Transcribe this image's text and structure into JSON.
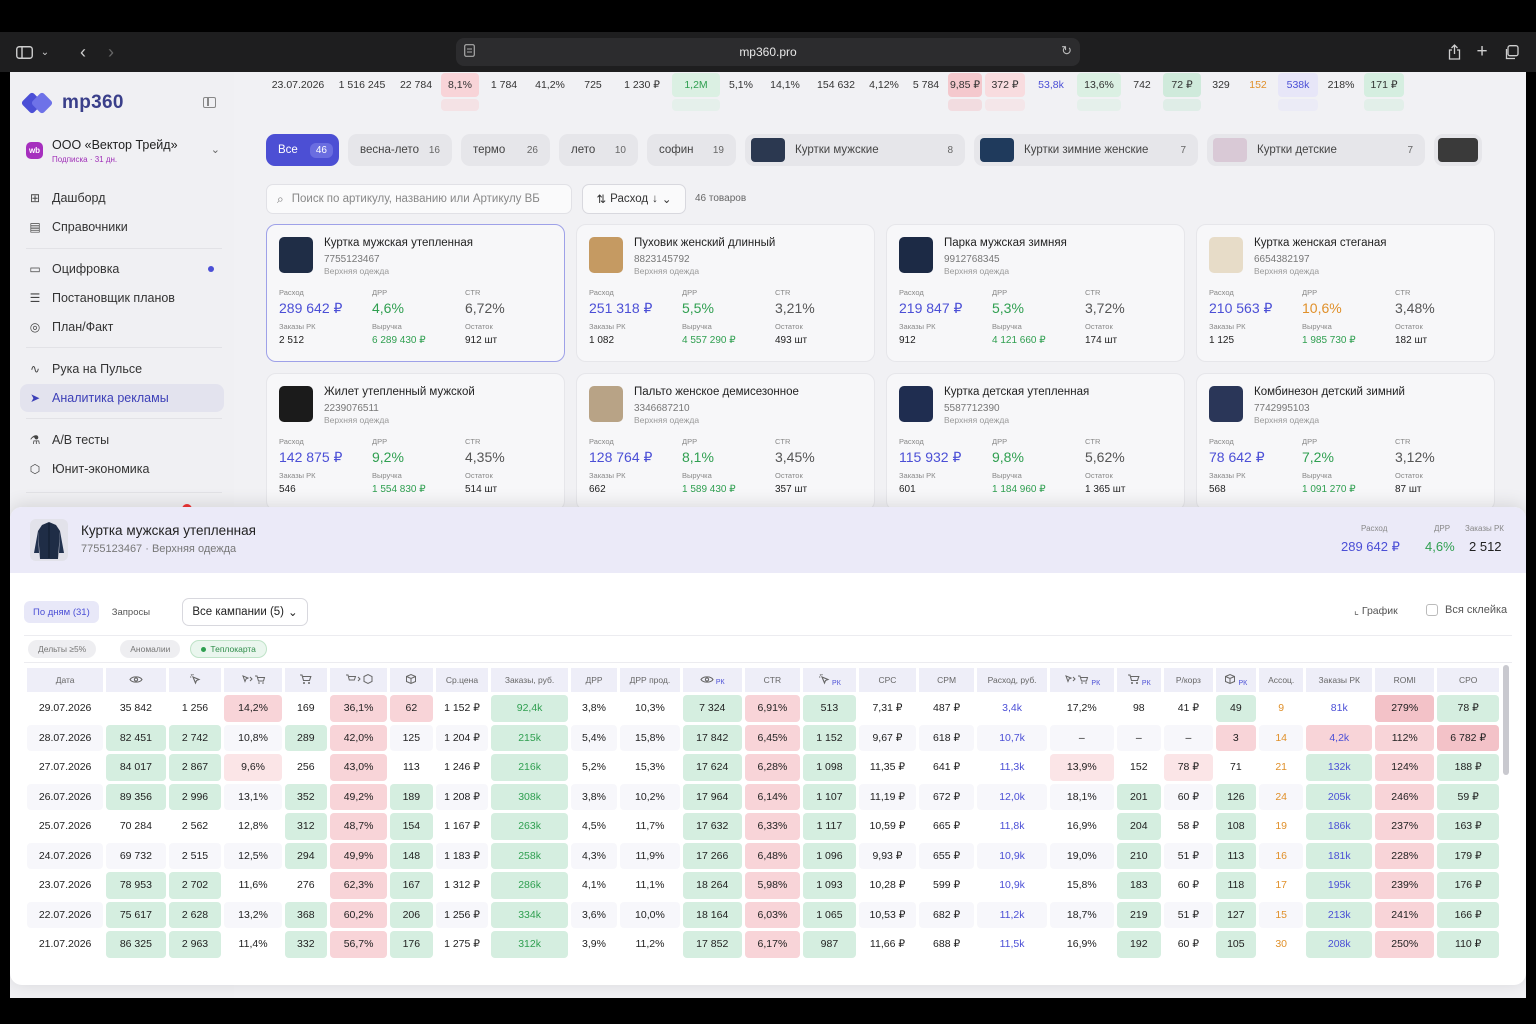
{
  "browser": {
    "url": "mp360.pro"
  },
  "sidebar": {
    "logo_text": "mp360",
    "org_badge": "wb",
    "org_name": "ООО «Вектор Трейд»",
    "org_sub": "Подписка · 31 дн.",
    "items": [
      {
        "label": "Дашборд",
        "icon": "grid-icon"
      },
      {
        "label": "Справочники",
        "icon": "book-icon"
      },
      {
        "label": "Оцифровка",
        "icon": "calendar-icon"
      },
      {
        "label": "Постановщик планов",
        "icon": "list-icon"
      },
      {
        "label": "План/Факт",
        "icon": "target-icon"
      },
      {
        "label": "Рука на Пульсе",
        "icon": "pulse-icon"
      },
      {
        "label": "Аналитика рекламы",
        "icon": "cursor-icon"
      },
      {
        "label": "А/В тесты",
        "icon": "flask-icon"
      },
      {
        "label": "Юнит-экономика",
        "icon": "cube-icon"
      }
    ]
  },
  "top_strip": {
    "rows": [
      [
        "23.07.2026",
        "1 516 245",
        "22 784",
        "8,1%",
        "1 784",
        "41,2%",
        "725",
        "1 230 ₽",
        "1,2M",
        "5,1%",
        "14,1%",
        "154 632",
        "4,12%",
        "5 784",
        "9,85 ₽",
        "372 ₽",
        "53,8k",
        "13,6%",
        "742",
        "72 ₽",
        "329",
        "152",
        "538k",
        "218%",
        "171 ₽"
      ]
    ]
  },
  "chips": [
    {
      "label": "Все",
      "count": "46"
    },
    {
      "label": "весна-лето",
      "count": "16"
    },
    {
      "label": "термо",
      "count": "26"
    },
    {
      "label": "лето",
      "count": "10"
    },
    {
      "label": "софин",
      "count": "19"
    },
    {
      "label": "Куртки мужские",
      "count": "8"
    },
    {
      "label": "Куртки зимние женские",
      "count": "7"
    },
    {
      "label": "Куртки детские",
      "count": "7"
    }
  ],
  "search": {
    "placeholder": "Поиск по артикулу, названию или Артикулу ВБ"
  },
  "sort": {
    "label": "Расход"
  },
  "products_count": "46 товаров",
  "card_labels": {
    "spend": "Расход",
    "drr": "ДРР",
    "ctr": "CTR",
    "orders": "Заказы РК",
    "revenue": "Выручка",
    "stock": "Остаток"
  },
  "cards": [
    {
      "title": "Куртка мужская утепленная",
      "article": "7755123467",
      "group": "Верхняя одежда",
      "spend": "289 642 ₽",
      "drr": "4,6%",
      "ctr": "6,72%",
      "orders": "2 512",
      "revenue": "6 289 430 ₽",
      "stock": "912 шт"
    },
    {
      "title": "Пуховик женский длинный",
      "article": "8823145792",
      "group": "Верхняя одежда",
      "spend": "251 318 ₽",
      "drr": "5,5%",
      "ctr": "3,21%",
      "orders": "1 082",
      "revenue": "4 557 290 ₽",
      "stock": "493 шт"
    },
    {
      "title": "Парка мужская зимняя",
      "article": "9912768345",
      "group": "Верхняя одежда",
      "spend": "219 847 ₽",
      "drr": "5,3%",
      "ctr": "3,72%",
      "orders": "912",
      "revenue": "4 121 660 ₽",
      "stock": "174 шт"
    },
    {
      "title": "Куртка женская стеганая",
      "article": "6654382197",
      "group": "Верхняя одежда",
      "spend": "210 563 ₽",
      "drr": "10,6%",
      "ctr": "3,48%",
      "orders": "1 125",
      "revenue": "1 985 730 ₽",
      "stock": "182 шт"
    },
    {
      "title": "Жилет утепленный мужской",
      "article": "2239076511",
      "group": "Верхняя одежда",
      "spend": "142 875 ₽",
      "drr": "9,2%",
      "ctr": "4,35%",
      "orders": "546",
      "revenue": "1 554 830 ₽",
      "stock": "514 шт"
    },
    {
      "title": "Пальто женское демисезонное",
      "article": "3346687210",
      "group": "Верхняя одежда",
      "spend": "128 764 ₽",
      "drr": "8,1%",
      "ctr": "3,45%",
      "orders": "662",
      "revenue": "1 589 430 ₽",
      "stock": "357 шт"
    },
    {
      "title": "Куртка детская утепленная",
      "article": "5587712390",
      "group": "Верхняя одежда",
      "spend": "115 932 ₽",
      "drr": "9,8%",
      "ctr": "5,62%",
      "orders": "601",
      "revenue": "1 184 960 ₽",
      "stock": "1 365 шт"
    },
    {
      "title": "Комбинезон детский зимний",
      "article": "7742995103",
      "group": "Верхняя одежда",
      "spend": "78 642 ₽",
      "drr": "7,2%",
      "ctr": "3,12%",
      "orders": "568",
      "revenue": "1 091 270 ₽",
      "stock": "87 шт"
    }
  ],
  "panel": {
    "title": "Куртка мужская утепленная",
    "subtitle": "7755123467 · Верхняя одежда",
    "spend_label": "Расход",
    "spend": "289 642 ₽",
    "drr_label": "ДРР",
    "drr": "4,6%",
    "orders_label": "Заказы РК",
    "orders": "2 512",
    "tab_days": "По дням (31)",
    "tab_queries": "Запросы",
    "campaigns": "Все кампании (5)",
    "graph": "График",
    "full": "Вся склейка",
    "filters": [
      "Дельты ≥5%",
      "Аномалии",
      "Теплокарта"
    ],
    "headers": [
      "Дата",
      "eye-icon",
      "click-icon",
      "click-cart-icon",
      "cart-icon",
      "cart-order-icon",
      "box-icon",
      "Ср.цена",
      "Заказы, руб.",
      "ДРР",
      "ДРР прод.",
      "eye-icon РК",
      "CTR",
      "click-icon РК",
      "CPC",
      "CPM",
      "Расход, руб.",
      "click-cart-icon РК",
      "cart-icon РК",
      "Р/корз",
      "box-icon РК",
      "Ассоц.",
      "Заказы РК",
      "ROMI",
      "CPO"
    ],
    "rows": [
      [
        "29.07.2026",
        "35 842",
        "1 256",
        "14,2%",
        "169",
        "36,1%",
        "62",
        "1 152 ₽",
        "92,4k",
        "3,8%",
        "10,3%",
        "7 324",
        "6,91%",
        "513",
        "7,31 ₽",
        "487 ₽",
        "3,4k",
        "17,2%",
        "98",
        "41 ₽",
        "49",
        "9",
        "81k",
        "279%",
        "78 ₽"
      ],
      [
        "28.07.2026",
        "82 451",
        "2 742",
        "10,8%",
        "289",
        "42,0%",
        "125",
        "1 204 ₽",
        "215k",
        "5,4%",
        "15,8%",
        "17 842",
        "6,45%",
        "1 152",
        "9,67 ₽",
        "618 ₽",
        "10,7k",
        "–",
        "–",
        "–",
        "3",
        "14",
        "4,2k",
        "112%",
        "6 782 ₽"
      ],
      [
        "27.07.2026",
        "84 017",
        "2 867",
        "9,6%",
        "256",
        "43,0%",
        "113",
        "1 246 ₽",
        "216k",
        "5,2%",
        "15,3%",
        "17 624",
        "6,28%",
        "1 098",
        "11,35 ₽",
        "641 ₽",
        "11,3k",
        "13,9%",
        "152",
        "78 ₽",
        "71",
        "21",
        "132k",
        "124%",
        "188 ₽"
      ],
      [
        "26.07.2026",
        "89 356",
        "2 996",
        "13,1%",
        "352",
        "49,2%",
        "189",
        "1 208 ₽",
        "308k",
        "3,8%",
        "10,2%",
        "17 964",
        "6,14%",
        "1 107",
        "11,19 ₽",
        "672 ₽",
        "12,0k",
        "18,1%",
        "201",
        "60 ₽",
        "126",
        "24",
        "205k",
        "246%",
        "59 ₽"
      ],
      [
        "25.07.2026",
        "70 284",
        "2 562",
        "12,8%",
        "312",
        "48,7%",
        "154",
        "1 167 ₽",
        "263k",
        "4,5%",
        "11,7%",
        "17 632",
        "6,33%",
        "1 117",
        "10,59 ₽",
        "665 ₽",
        "11,8k",
        "16,9%",
        "204",
        "58 ₽",
        "108",
        "19",
        "186k",
        "237%",
        "163 ₽"
      ],
      [
        "24.07.2026",
        "69 732",
        "2 515",
        "12,5%",
        "294",
        "49,9%",
        "148",
        "1 183 ₽",
        "258k",
        "4,3%",
        "11,9%",
        "17 266",
        "6,48%",
        "1 096",
        "9,93 ₽",
        "655 ₽",
        "10,9k",
        "19,0%",
        "210",
        "51 ₽",
        "113",
        "16",
        "181k",
        "228%",
        "179 ₽"
      ],
      [
        "23.07.2026",
        "78 953",
        "2 702",
        "11,6%",
        "276",
        "62,3%",
        "167",
        "1 312 ₽",
        "286k",
        "4,1%",
        "11,1%",
        "18 264",
        "5,98%",
        "1 093",
        "10,28 ₽",
        "599 ₽",
        "10,9k",
        "15,8%",
        "183",
        "60 ₽",
        "118",
        "17",
        "195k",
        "239%",
        "176 ₽"
      ],
      [
        "22.07.2026",
        "75 617",
        "2 628",
        "13,2%",
        "368",
        "60,2%",
        "206",
        "1 256 ₽",
        "334k",
        "3,6%",
        "10,0%",
        "18 164",
        "6,03%",
        "1 065",
        "10,53 ₽",
        "682 ₽",
        "11,2k",
        "18,7%",
        "219",
        "51 ₽",
        "127",
        "15",
        "213k",
        "241%",
        "166 ₽"
      ],
      [
        "21.07.2026",
        "86 325",
        "2 963",
        "11,4%",
        "332",
        "56,7%",
        "176",
        "1 275 ₽",
        "312k",
        "3,9%",
        "11,2%",
        "17 852",
        "6,17%",
        "987",
        "11,66 ₽",
        "688 ₽",
        "11,5k",
        "16,9%",
        "192",
        "60 ₽",
        "105",
        "30",
        "208k",
        "250%",
        "110 ₽"
      ]
    ]
  },
  "colors": {
    "accent": "#4b4fd6",
    "green": "#2f9f50",
    "orange": "#e0902a",
    "red_bg": "#f8d4d8",
    "green_bg": "#d5eee0"
  }
}
